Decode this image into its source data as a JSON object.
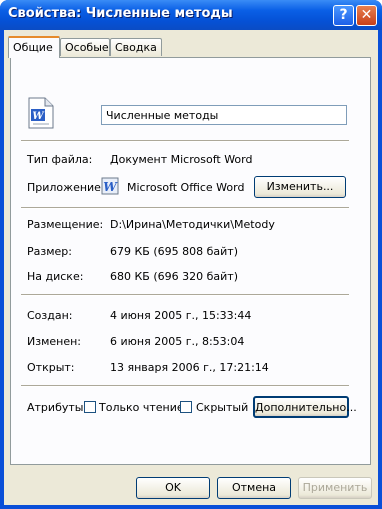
{
  "window": {
    "title": "Свойства: Численные  методы"
  },
  "title_buttons": {
    "help": "?",
    "close": "✕"
  },
  "tabs": [
    "Общие",
    "Особые",
    "Сводка"
  ],
  "general": {
    "file_name": "Численные  методы",
    "type_label": "Тип файла:",
    "type_value": "Документ Microsoft Word",
    "app_label": "Приложение:",
    "app_value": "Microsoft Office Word",
    "change_button": "Изменить...",
    "location_label": "Размещение:",
    "location_value": "D:\\Ирина\\Методички\\Metody",
    "size_label": "Размер:",
    "size_value": "679 КБ (695 808 байт)",
    "disk_label": "На диске:",
    "disk_value": "680 КБ (696 320 байт)",
    "created_label": "Создан:",
    "created_value": "4 июня 2005 г., 15:33:44",
    "modified_label": "Изменен:",
    "modified_value": "6 июня 2005 г., 8:53:04",
    "opened_label": "Открыт:",
    "opened_value": "13 января 2006 г., 17:21:14",
    "attributes_label": "Атрибуты:",
    "readonly_label": "Только чтение",
    "hidden_label": "Скрытый",
    "advanced_button": "Дополнительно..."
  },
  "footer": {
    "ok": "OK",
    "cancel": "Отмена",
    "apply": "Применить"
  },
  "icons": {
    "file": "word-document-icon",
    "app": "word-app-icon"
  }
}
